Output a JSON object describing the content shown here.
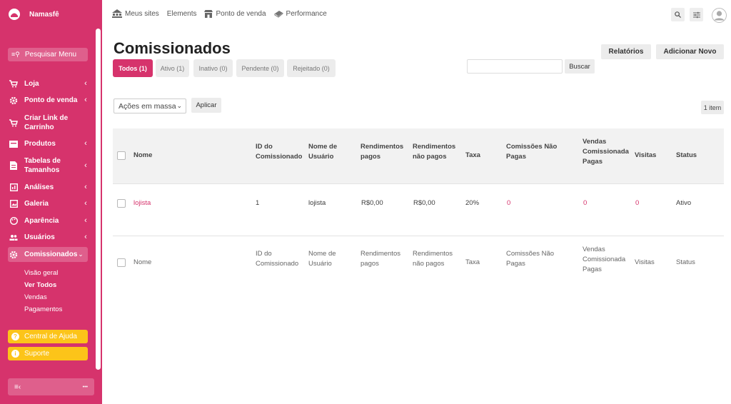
{
  "brand": {
    "name": "Namasfê"
  },
  "sidebar": {
    "search_label": "Pesquisar Menu",
    "items": [
      {
        "label": "Loja",
        "icon": "cart-icon"
      },
      {
        "label": "Ponto de venda",
        "icon": "gear-icon"
      },
      {
        "label": "Criar Link de Carrinho",
        "icon": "cart-icon"
      },
      {
        "label": "Produtos",
        "icon": "box-icon"
      },
      {
        "label": "Tabelas de Tamanhos",
        "icon": "document-icon"
      },
      {
        "label": "Análises",
        "icon": "analytics-icon"
      },
      {
        "label": "Galeria",
        "icon": "gallery-icon"
      },
      {
        "label": "Aparência",
        "icon": "palette-icon"
      },
      {
        "label": "Usuários",
        "icon": "users-icon"
      },
      {
        "label": "Comissionados",
        "icon": "gear-icon"
      }
    ],
    "subitems": [
      "Visão geral",
      "Ver Todos",
      "Vendas",
      "Pagamentos"
    ],
    "help_label": "Central de Ajuda",
    "support_label": "Suporte",
    "more_label": "•••"
  },
  "topbar": {
    "links": [
      "Meus sites",
      "Elements",
      "Ponto de venda",
      "Performance"
    ]
  },
  "page": {
    "title": "Comissionados",
    "reports_label": "Relatórios",
    "add_new_label": "Adicionar Novo",
    "tabs": [
      "Todos (1)",
      "Ativo (1)",
      "Inativo (0)",
      "Pendente (0)",
      "Rejeitado (0)"
    ],
    "search_button": "Buscar",
    "bulk_actions": "Ações em massa",
    "apply_label": "Aplicar",
    "item_count": "1 item"
  },
  "table": {
    "headers": [
      "Nome",
      "ID do Comissionado",
      "Nome de Usuário",
      "Rendimentos pagos",
      "Rendimentos não pagos",
      "Taxa",
      "Comissões Não Pagas",
      "Vendas Comissionada Pagas",
      "Visitas",
      "Status"
    ],
    "header_lines": {
      "id": [
        "ID do",
        "Comissionado"
      ],
      "user": [
        "Nome de",
        "Usuário"
      ],
      "paid": [
        "Rendimentos",
        "pagos"
      ],
      "unpaid": [
        "Rendimentos",
        "não pagos"
      ],
      "unpaid_comm": [
        "Comissões Não",
        "Pagas"
      ],
      "sales": [
        "Vendas",
        "Comissionada",
        "Pagas"
      ]
    },
    "rows": [
      {
        "name": "lojista",
        "id": "1",
        "user": "lojista",
        "paid": "R$0,00",
        "unpaid": "R$0,00",
        "rate": "20%",
        "unpaid_commissions": "0",
        "paid_sales": "0",
        "visits": "0",
        "status": "Ativo"
      }
    ]
  },
  "colors": {
    "accent": "#d6336c",
    "help": "#fcc419"
  }
}
